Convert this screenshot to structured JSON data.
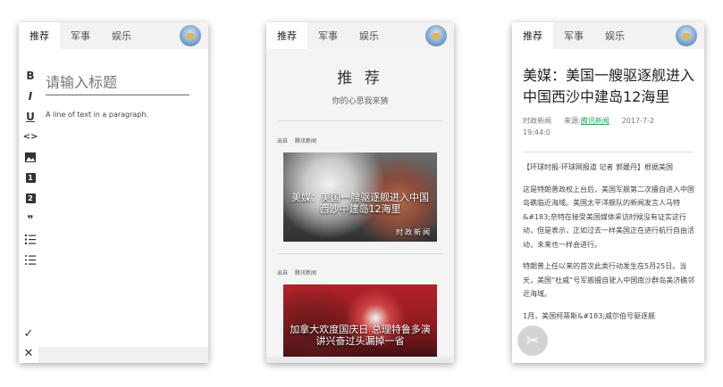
{
  "tabs": {
    "recommend": "推荐",
    "military": "军事",
    "entertainment": "娱乐"
  },
  "editor": {
    "title_placeholder": "请输入标题",
    "paragraph": "A line of text in a paragraph.",
    "toolbar": {
      "bold": "B",
      "italic": "I",
      "underline": "U",
      "code": "<>",
      "image": "▲",
      "heading1": "1",
      "heading2": "2",
      "quote": "❞",
      "ordered_list": "☰",
      "unordered_list": "☰"
    },
    "confirm": "✓",
    "close": "✕"
  },
  "feed": {
    "title": "推 荐",
    "subtitle": "你的心思我来猜",
    "cards": [
      {
        "from_label": "出自",
        "source": "腾讯新闻",
        "headline": "美媒：美国一艘驱逐舰进入中国西沙中建岛12海里",
        "tag": "时政新闻"
      },
      {
        "from_label": "出自",
        "source": "腾讯新闻",
        "headline": "加拿大欢度国庆日 总理特鲁多演讲兴奋过头漏掉一省",
        "tag": ""
      }
    ]
  },
  "article": {
    "title": "美媒：美国一艘驱逐舰进入中国西沙中建岛12海里",
    "category": "时政新闻",
    "source_label": "来源:",
    "source_name": "腾讯新闻",
    "date": "2017-7-2",
    "time": "19:44:0",
    "paragraphs": [
      "【环球时报-环球网报道 记者 郭媛丹】根据美国",
      "这是特朗普政权上台后，美国军舰第二次擅自进入中国岛礁临近海域。美国太平洋舰队的新闻发言人马特&#183;奈特在接受美国媒体采访时候没有证实这行动，但是表示，正如过去一样美国正在进行航行自由活动，未来也一样会进行。",
      "特朗普上任以来的首次此类行动发生在5月25日。当天，美国“杜威”号军舰擅自驶入中国南沙群岛美济礁邻近海域。",
      "1月，美国柯蒂斯&#183;威尔伯号驱逐舰"
    ]
  }
}
